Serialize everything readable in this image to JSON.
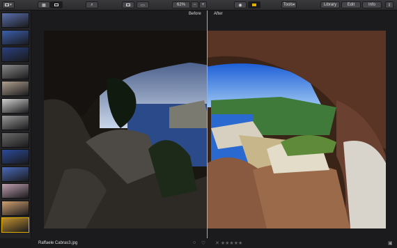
{
  "toolbar": {
    "zoom": "62%",
    "minus": "−",
    "plus": "+",
    "tools": "Tools",
    "library": "Library",
    "edit": "Edit",
    "info": "Info",
    "dropdown_caret": "▾"
  },
  "compare": {
    "before": "Before",
    "after": "After"
  },
  "status": {
    "filename": "Raffaele Cabras3.jpg",
    "rating": "☆★★★★★",
    "reject": "✕",
    "heart": "♡",
    "circle": "○",
    "trash": "🗑"
  },
  "filmstrip": {
    "thumb_colors": [
      "#5a6fae",
      "#3c5fae",
      "#2a3f7e",
      "#8a8a8a",
      "#b0a090",
      "#cfcfcf",
      "#9a9a9a",
      "#6a6a6a",
      "#2a4a9a",
      "#4a6aba",
      "#c0a0b0",
      "#d0a070",
      "#c09030"
    ],
    "selected_index": 12
  },
  "colors": {
    "accent": "#e3b100",
    "background": "#1a1a1c"
  }
}
